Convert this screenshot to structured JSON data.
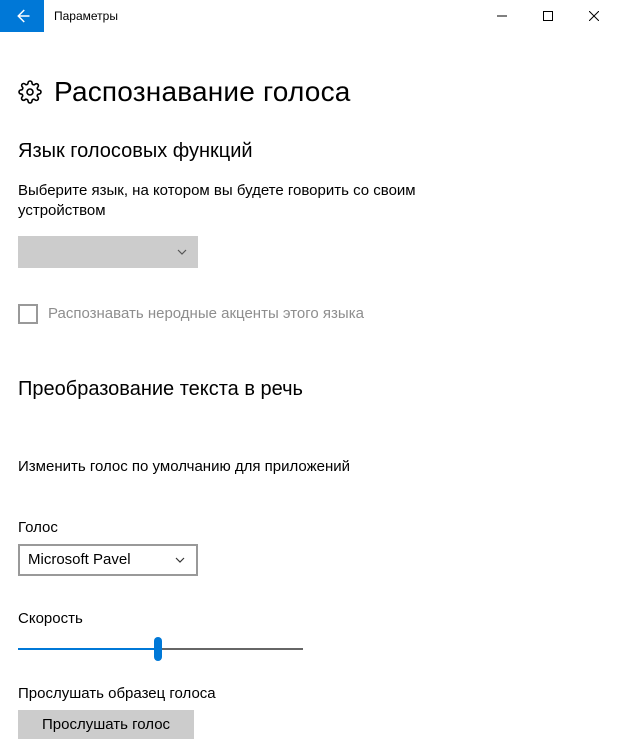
{
  "titlebar": {
    "title": "Параметры"
  },
  "page": {
    "title": "Распознавание голоса"
  },
  "section1": {
    "heading": "Язык голосовых функций",
    "description": "Выберите язык, на котором вы будете говорить со своим устройством",
    "checkbox_label": "Распознавать неродные акценты этого языка"
  },
  "section2": {
    "heading": "Преобразование текста в речь",
    "description": "Изменить голос по умолчанию для приложений",
    "voice_label": "Голос",
    "voice_value": "Microsoft Pavel",
    "speed_label": "Скорость",
    "sample_label": "Прослушать образец голоса",
    "sample_button": "Прослушать голос"
  }
}
